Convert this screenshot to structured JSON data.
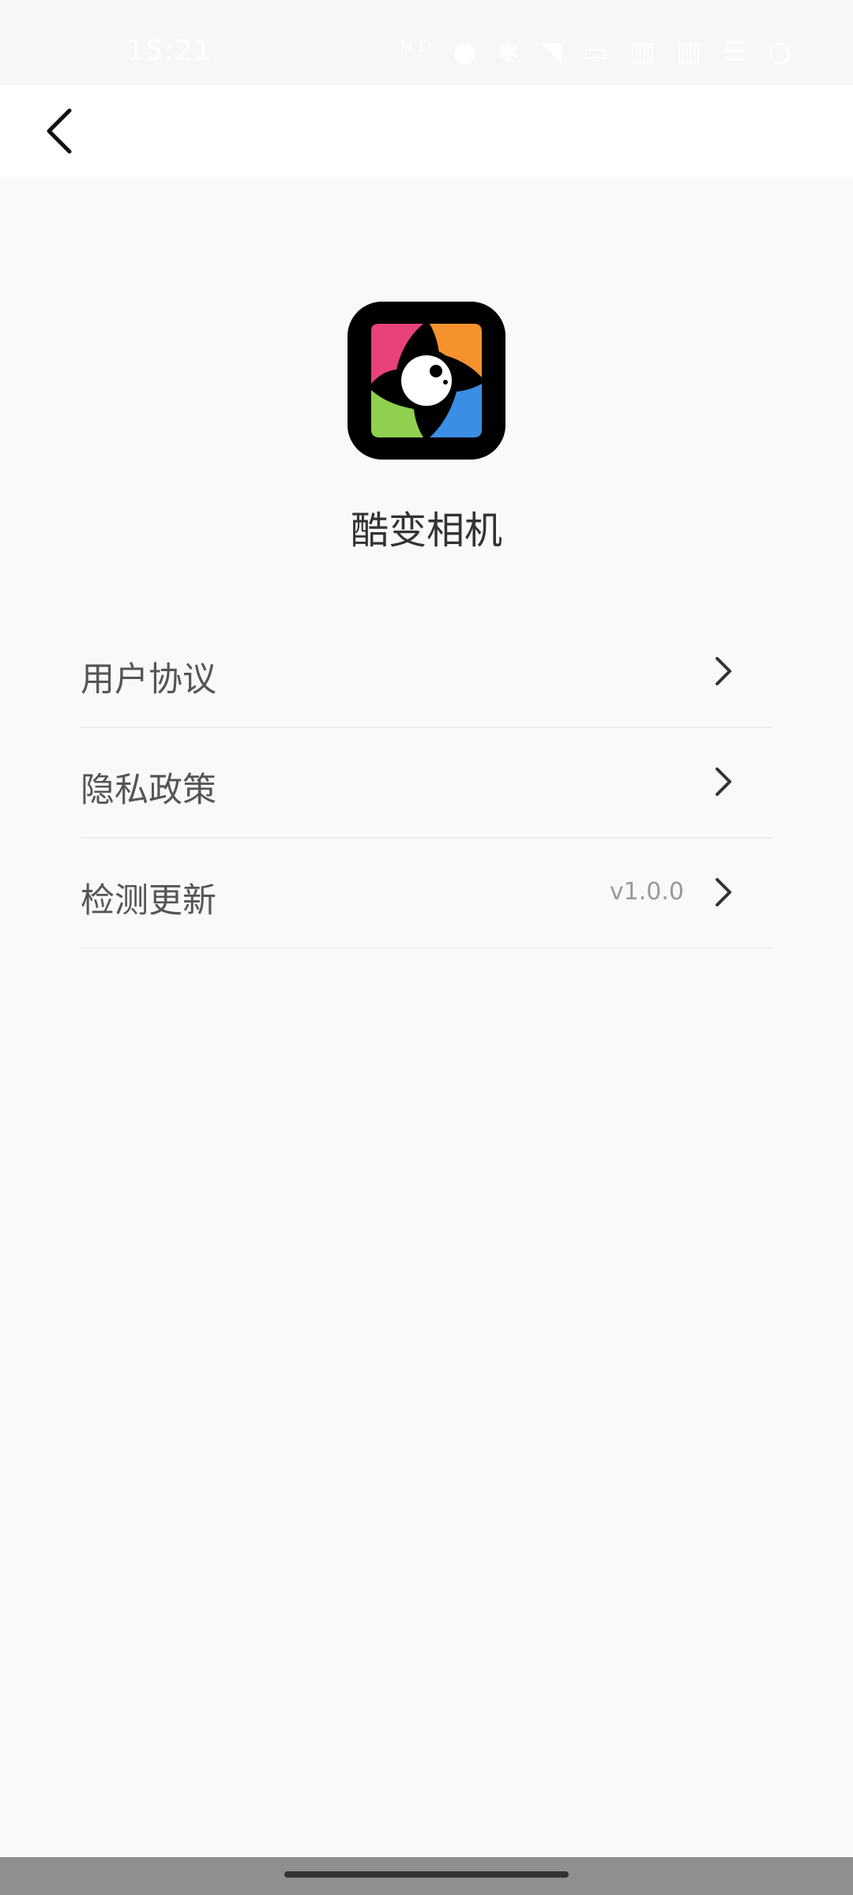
{
  "status_bar": {
    "time": "15:21",
    "icons": "ᴴᴰ ● ✱ ◥ ▭ ▥ ▥ ☰ ○"
  },
  "app": {
    "name": "酷变相机"
  },
  "menu": {
    "items": [
      {
        "label": "用户协议",
        "value": ""
      },
      {
        "label": "隐私政策",
        "value": ""
      },
      {
        "label": "检测更新",
        "value": "v1.0.0"
      }
    ]
  },
  "colors": {
    "background": "#f9f9f9",
    "app_bar": "#ffffff",
    "text_primary": "#333333",
    "text_secondary": "#999999",
    "divider": "#eeeeee"
  }
}
